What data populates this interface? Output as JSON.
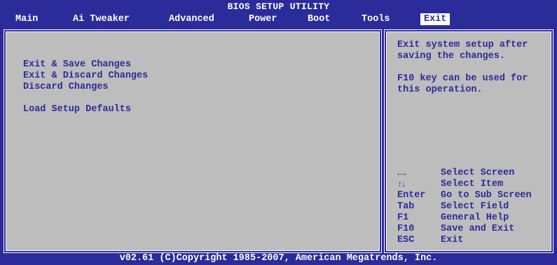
{
  "header": {
    "title": "BIOS SETUP UTILITY"
  },
  "menu": {
    "items": [
      {
        "label": "Main"
      },
      {
        "label": "Ai Tweaker"
      },
      {
        "label": "Advanced"
      },
      {
        "label": "Power"
      },
      {
        "label": "Boot"
      },
      {
        "label": "Tools"
      },
      {
        "label": "Exit",
        "active": true
      }
    ]
  },
  "options": {
    "exit_save": "Exit & Save Changes",
    "exit_discard": "Exit & Discard Changes",
    "discard": "Discard Changes",
    "load_defaults": "Load Setup Defaults"
  },
  "help": {
    "line1": "Exit system setup after",
    "line2": "saving the changes.",
    "line3": "F10 key can be used for",
    "line4": "this operation."
  },
  "keys": [
    {
      "key": "←→",
      "icon": "left-right-arrows-icon",
      "desc": "Select Screen"
    },
    {
      "key": "↑↓",
      "icon": "up-down-arrows-icon",
      "desc": "Select Item"
    },
    {
      "key": "Enter",
      "desc": "Go to Sub Screen"
    },
    {
      "key": "Tab",
      "desc": "Select Field"
    },
    {
      "key": "F1",
      "desc": "General Help"
    },
    {
      "key": "F10",
      "desc": "Save and Exit"
    },
    {
      "key": "ESC",
      "desc": "Exit"
    }
  ],
  "footer": {
    "copyright": "v02.61 (C)Copyright 1985-2007, American Megatrends, Inc."
  },
  "colors": {
    "background": "#2b2b9a",
    "panel": "#bdbdbd",
    "text": "#2b2b9a",
    "highlight": "#ffffff"
  }
}
